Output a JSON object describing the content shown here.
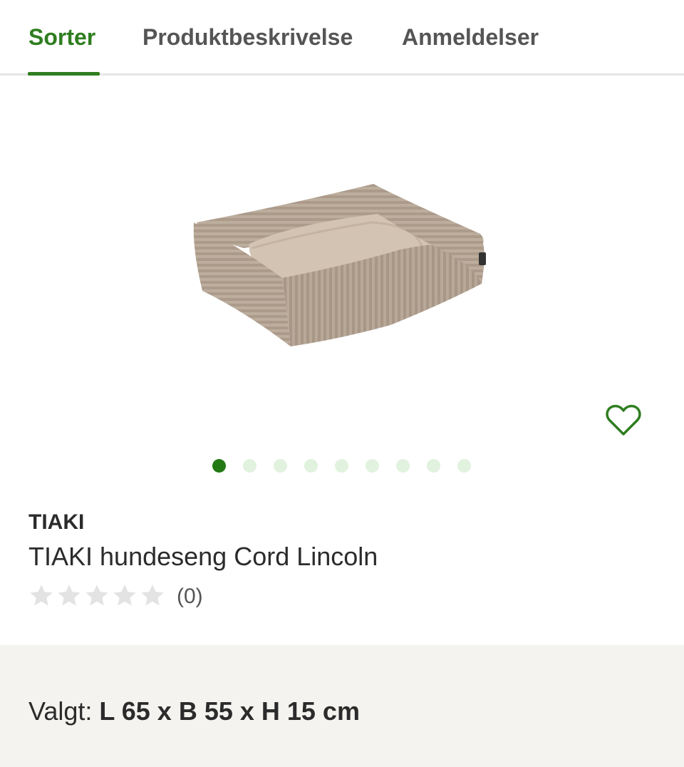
{
  "tabs": [
    {
      "label": "Sorter",
      "active": true
    },
    {
      "label": "Produktbeskrivelse",
      "active": false
    },
    {
      "label": "Anmeldelser",
      "active": false
    }
  ],
  "colors": {
    "accent": "#2f7d20",
    "dot_active": "#237a14",
    "dot_inactive": "#e1f2de",
    "panel_bg": "#f4f3ef",
    "star_empty": "#e3e3e3"
  },
  "gallery": {
    "image": "dog-bed-product-image",
    "image_count": 9,
    "current_index": 1
  },
  "favorite": {
    "icon": "heart-outline-icon"
  },
  "product": {
    "brand": "TIAKI",
    "title": "TIAKI hundeseng Cord Lincoln",
    "rating": 0,
    "rating_max": 5,
    "review_count": "(0)"
  },
  "variant": {
    "label": "Valgt:",
    "value": "L 65 x B 55 x H 15 cm"
  }
}
